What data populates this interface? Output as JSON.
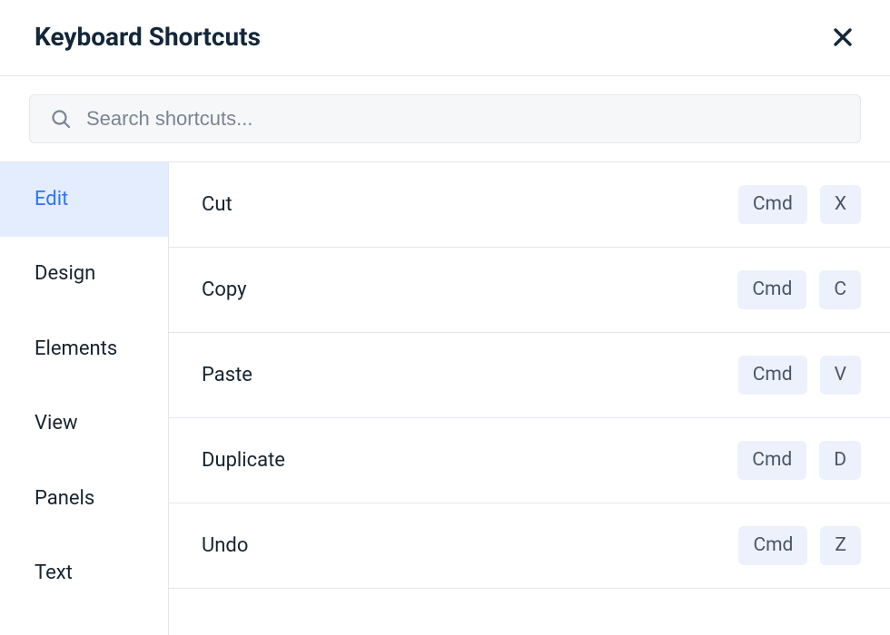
{
  "title": "Keyboard Shortcuts",
  "search": {
    "placeholder": "Search shortcuts..."
  },
  "sidebar": {
    "items": [
      {
        "label": "Edit",
        "active": true
      },
      {
        "label": "Design",
        "active": false
      },
      {
        "label": "Elements",
        "active": false
      },
      {
        "label": "View",
        "active": false
      },
      {
        "label": "Panels",
        "active": false
      },
      {
        "label": "Text",
        "active": false
      }
    ]
  },
  "shortcuts": [
    {
      "label": "Cut",
      "keys": [
        "Cmd",
        "X"
      ]
    },
    {
      "label": "Copy",
      "keys": [
        "Cmd",
        "C"
      ]
    },
    {
      "label": "Paste",
      "keys": [
        "Cmd",
        "V"
      ]
    },
    {
      "label": "Duplicate",
      "keys": [
        "Cmd",
        "D"
      ]
    },
    {
      "label": "Undo",
      "keys": [
        "Cmd",
        "Z"
      ]
    }
  ]
}
